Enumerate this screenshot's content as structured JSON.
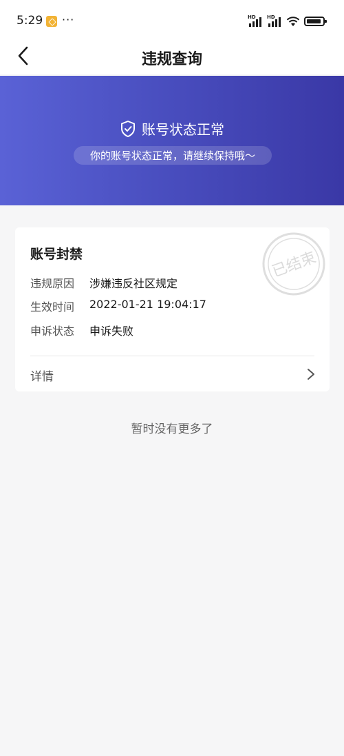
{
  "status_bar": {
    "time": "5:29",
    "more": "···",
    "signal_label": "HD"
  },
  "header": {
    "title": "违规查询"
  },
  "banner": {
    "title": "账号状态正常",
    "subtitle": "你的账号状态正常，请继续保持哦～"
  },
  "record": {
    "title": "账号封禁",
    "stamp_text": "已结束",
    "fields": [
      {
        "label": "违规原因",
        "value": "涉嫌违反社区规定"
      },
      {
        "label": "生效时间",
        "value": "2022-01-21 19:04:17"
      },
      {
        "label": "申诉状态",
        "value": "申诉失败"
      }
    ],
    "detail_label": "详情"
  },
  "footer": {
    "no_more_text": "暂时没有更多了"
  },
  "colors": {
    "banner_start": "#5a62d6",
    "banner_end": "#3a38a6",
    "page_background": "#f6f6f7"
  }
}
